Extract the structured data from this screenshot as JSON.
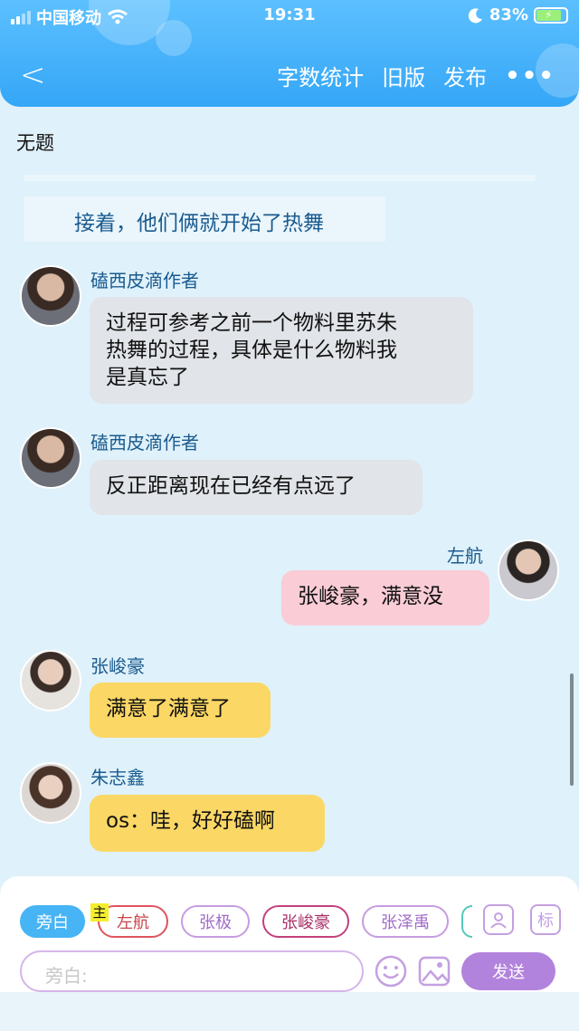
{
  "status_bar": {
    "carrier": "中国移动",
    "time": "19:31",
    "battery": "83%"
  },
  "nav": {
    "back": "<",
    "actions": [
      "字数统计",
      "旧版",
      "发布"
    ],
    "more": "•••"
  },
  "document": {
    "title": "无题"
  },
  "narration": "接着，他们俩就开始了热舞",
  "messages": [
    {
      "name": "磕西皮滴作者",
      "text": "过程可参考之前一个物料里苏朱\n热舞的过程，具体是什么物料我\n是真忘了"
    },
    {
      "name": "磕西皮滴作者",
      "text": "反正距离现在已经有点远了"
    },
    {
      "name": "左航",
      "text": "张峻豪，满意没"
    },
    {
      "name": "张峻豪",
      "text": "满意了满意了"
    },
    {
      "name": "朱志鑫",
      "text": "os：哇，好好磕啊"
    }
  ],
  "composer": {
    "roles": [
      "旁白",
      "左航",
      "张极",
      "张峻豪",
      "张泽禹"
    ],
    "host_badge": "主",
    "tag_icon": "标",
    "placeholder": "旁白:",
    "send": "发送"
  },
  "colors": {
    "header": "#35a6f7",
    "page_bg": "#dff1fa",
    "send": "#b283dc"
  },
  "icons": [
    "wifi-icon",
    "moon-icon",
    "battery-icon",
    "back-chevron-icon",
    "more-icon",
    "person-icon",
    "emoji-icon",
    "image-icon"
  ]
}
